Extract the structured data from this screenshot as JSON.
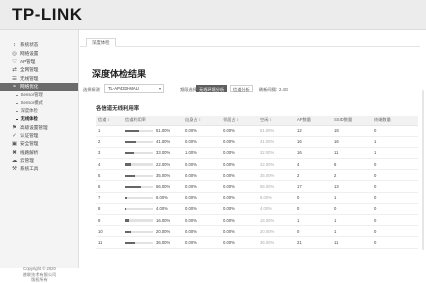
{
  "brand": "TP-LINK",
  "sidebar": {
    "items": [
      {
        "icon": "chart-icon",
        "glyph": "↕",
        "label": "系统状态"
      },
      {
        "icon": "network-icon",
        "glyph": "◎",
        "label": "网络设置"
      },
      {
        "icon": "ap-icon",
        "glyph": "♡",
        "label": "AP管理"
      },
      {
        "icon": "switch-icon",
        "glyph": "⇄",
        "label": "全网管理"
      },
      {
        "icon": "wireless-icon",
        "glyph": "☰",
        "label": "无线管理"
      },
      {
        "icon": "wifi-icon",
        "glyph": "≈",
        "label": "网络优化",
        "active": true
      }
    ],
    "subitems": [
      {
        "label": "Sensor管理"
      },
      {
        "label": "Sensor模式"
      },
      {
        "label": "深度体检"
      },
      {
        "label": "无线体检",
        "current": true
      }
    ],
    "items_after": [
      {
        "icon": "advanced-icon",
        "glyph": "⚑",
        "label": "高级设置管理"
      },
      {
        "icon": "auth-icon",
        "glyph": "✓",
        "label": "认证管理"
      },
      {
        "icon": "security-icon",
        "glyph": "▣",
        "label": "安全管理"
      },
      {
        "icon": "behavior-icon",
        "glyph": "✖",
        "label": "线路解析"
      },
      {
        "icon": "cloud-icon",
        "glyph": "☁",
        "label": "云管理"
      },
      {
        "icon": "tools-icon",
        "glyph": "⚒",
        "label": "系统工具"
      }
    ]
  },
  "copyright": {
    "line1": "Copyright © 2020",
    "line2": "普联技术有限公司",
    "line3": "版权所有"
  },
  "tab_label": "深度体检",
  "page_title": "深度体检结果",
  "filters": {
    "sensor_label": "选择探测",
    "sensor_value": "TL-AP433I-MAU",
    "band_label": "频段选择",
    "band_options": [
      "无线环境分析",
      "信道分析"
    ],
    "band_selected": 0,
    "interval_label": "刷新间隔：",
    "interval_value": "2.4G"
  },
  "section_title": "各信道无线利用率",
  "table": {
    "headers": [
      "信道 ↕",
      "信道利用率",
      "自身占 ↕",
      "邻居占 ↕",
      "空闲 ↕",
      "AP数量",
      "SSID数量",
      "终端数量"
    ],
    "rows": [
      {
        "ch": "1",
        "util": "51.00%",
        "self": "0.00%",
        "neigh": "0.00%",
        "idle": "51.00%",
        "ap": "12",
        "ssid": "18",
        "sta": "0",
        "fill": 0.51
      },
      {
        "ch": "2",
        "util": "41.00%",
        "self": "0.00%",
        "neigh": "0.00%",
        "idle": "41.00%",
        "ap": "16",
        "ssid": "16",
        "sta": "1",
        "fill": 0.41
      },
      {
        "ch": "3",
        "util": "33.00%",
        "self": "1.00%",
        "neigh": "0.00%",
        "idle": "32.00%",
        "ap": "16",
        "ssid": "11",
        "sta": "1",
        "fill": 0.33
      },
      {
        "ch": "4",
        "util": "22.00%",
        "self": "0.00%",
        "neigh": "0.00%",
        "idle": "22.00%",
        "ap": "4",
        "ssid": "6",
        "sta": "0",
        "fill": 0.22
      },
      {
        "ch": "5",
        "util": "35.00%",
        "self": "0.00%",
        "neigh": "0.00%",
        "idle": "35.00%",
        "ap": "2",
        "ssid": "2",
        "sta": "0",
        "fill": 0.35
      },
      {
        "ch": "6",
        "util": "56.00%",
        "self": "0.00%",
        "neigh": "0.00%",
        "idle": "56.00%",
        "ap": "17",
        "ssid": "13",
        "sta": "0",
        "fill": 0.56
      },
      {
        "ch": "7",
        "util": "6.00%",
        "self": "0.00%",
        "neigh": "0.00%",
        "idle": "6.00%",
        "ap": "0",
        "ssid": "1",
        "sta": "0",
        "fill": 0.06
      },
      {
        "ch": "8",
        "util": "4.00%",
        "self": "0.00%",
        "neigh": "0.00%",
        "idle": "4.00%",
        "ap": "0",
        "ssid": "0",
        "sta": "0",
        "fill": 0.04
      },
      {
        "ch": "9",
        "util": "16.00%",
        "self": "0.00%",
        "neigh": "0.00%",
        "idle": "16.00%",
        "ap": "1",
        "ssid": "1",
        "sta": "0",
        "fill": 0.16
      },
      {
        "ch": "10",
        "util": "20.00%",
        "self": "0.00%",
        "neigh": "0.00%",
        "idle": "20.00%",
        "ap": "0",
        "ssid": "1",
        "sta": "0",
        "fill": 0.2
      },
      {
        "ch": "11",
        "util": "36.00%",
        "self": "0.00%",
        "neigh": "0.00%",
        "idle": "36.00%",
        "ap": "21",
        "ssid": "11",
        "sta": "0",
        "fill": 0.36
      }
    ]
  }
}
